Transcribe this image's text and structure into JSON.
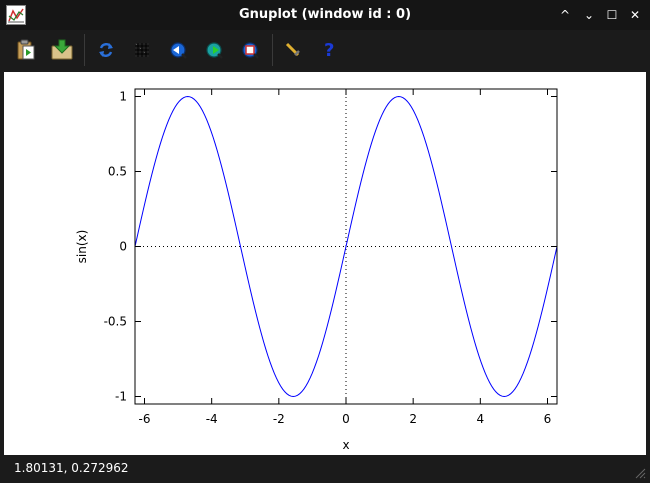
{
  "window": {
    "title": "Gnuplot (window id : 0)",
    "controls": [
      "^",
      "⌄",
      "☐",
      "✕"
    ]
  },
  "toolbar": {
    "buttons": [
      {
        "icon": "clipboard-copy-icon",
        "label": "Copy to clipboard"
      },
      {
        "icon": "export-icon",
        "label": "Export"
      },
      {
        "icon": "replot-icon",
        "label": "Replot"
      },
      {
        "icon": "grid-icon",
        "label": "Show grid"
      },
      {
        "icon": "zoom-previous-icon",
        "label": "Previous zoom"
      },
      {
        "icon": "zoom-next-icon",
        "label": "Next zoom"
      },
      {
        "icon": "autoscale-icon",
        "label": "Autoscale"
      },
      {
        "icon": "settings-icon",
        "label": "Settings"
      },
      {
        "icon": "help-icon",
        "label": "Help"
      }
    ]
  },
  "colors": {
    "curve": "#0000ff",
    "frame": "#000000",
    "background": "#ffffff",
    "chrome": "#1b1b1b"
  },
  "chart_data": {
    "type": "line",
    "function": "sin(x)",
    "xlabel": "x",
    "ylabel": "sin(x)",
    "xlim": [
      -6.283185,
      6.283185
    ],
    "ylim": [
      -1.05,
      1.05
    ],
    "xticks": [
      -6,
      -4,
      -2,
      0,
      2,
      4,
      6
    ],
    "xtick_labels": [
      "-6",
      "-4",
      "-2",
      "0",
      "2",
      "4",
      "6"
    ],
    "yticks": [
      -1,
      -0.5,
      0,
      0.5,
      1
    ],
    "ytick_labels": [
      "-1",
      "-0.5",
      "0",
      "0.5",
      "1"
    ],
    "zero_axes_dotted": true,
    "grid": false,
    "series": [
      {
        "color": "#0000ff",
        "samples": 200
      }
    ]
  },
  "status": {
    "coordinates": "1.80131,  0.272962"
  }
}
